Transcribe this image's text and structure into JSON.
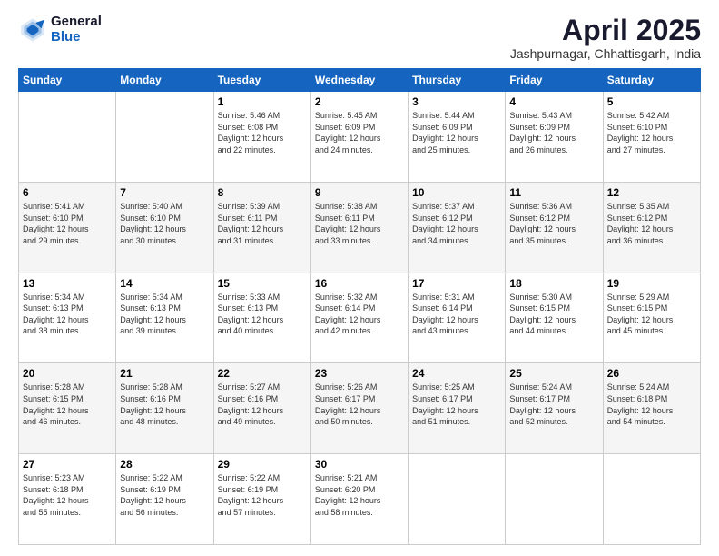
{
  "header": {
    "logo_general": "General",
    "logo_blue": "Blue",
    "title": "April 2025",
    "location": "Jashpurnagar, Chhattisgarh, India"
  },
  "days_of_week": [
    "Sunday",
    "Monday",
    "Tuesday",
    "Wednesday",
    "Thursday",
    "Friday",
    "Saturday"
  ],
  "weeks": [
    [
      {
        "day": "",
        "sunrise": "",
        "sunset": "",
        "daylight": ""
      },
      {
        "day": "",
        "sunrise": "",
        "sunset": "",
        "daylight": ""
      },
      {
        "day": "1",
        "sunrise": "Sunrise: 5:46 AM",
        "sunset": "Sunset: 6:08 PM",
        "daylight": "Daylight: 12 hours and 22 minutes."
      },
      {
        "day": "2",
        "sunrise": "Sunrise: 5:45 AM",
        "sunset": "Sunset: 6:09 PM",
        "daylight": "Daylight: 12 hours and 24 minutes."
      },
      {
        "day": "3",
        "sunrise": "Sunrise: 5:44 AM",
        "sunset": "Sunset: 6:09 PM",
        "daylight": "Daylight: 12 hours and 25 minutes."
      },
      {
        "day": "4",
        "sunrise": "Sunrise: 5:43 AM",
        "sunset": "Sunset: 6:09 PM",
        "daylight": "Daylight: 12 hours and 26 minutes."
      },
      {
        "day": "5",
        "sunrise": "Sunrise: 5:42 AM",
        "sunset": "Sunset: 6:10 PM",
        "daylight": "Daylight: 12 hours and 27 minutes."
      }
    ],
    [
      {
        "day": "6",
        "sunrise": "Sunrise: 5:41 AM",
        "sunset": "Sunset: 6:10 PM",
        "daylight": "Daylight: 12 hours and 29 minutes."
      },
      {
        "day": "7",
        "sunrise": "Sunrise: 5:40 AM",
        "sunset": "Sunset: 6:10 PM",
        "daylight": "Daylight: 12 hours and 30 minutes."
      },
      {
        "day": "8",
        "sunrise": "Sunrise: 5:39 AM",
        "sunset": "Sunset: 6:11 PM",
        "daylight": "Daylight: 12 hours and 31 minutes."
      },
      {
        "day": "9",
        "sunrise": "Sunrise: 5:38 AM",
        "sunset": "Sunset: 6:11 PM",
        "daylight": "Daylight: 12 hours and 33 minutes."
      },
      {
        "day": "10",
        "sunrise": "Sunrise: 5:37 AM",
        "sunset": "Sunset: 6:12 PM",
        "daylight": "Daylight: 12 hours and 34 minutes."
      },
      {
        "day": "11",
        "sunrise": "Sunrise: 5:36 AM",
        "sunset": "Sunset: 6:12 PM",
        "daylight": "Daylight: 12 hours and 35 minutes."
      },
      {
        "day": "12",
        "sunrise": "Sunrise: 5:35 AM",
        "sunset": "Sunset: 6:12 PM",
        "daylight": "Daylight: 12 hours and 36 minutes."
      }
    ],
    [
      {
        "day": "13",
        "sunrise": "Sunrise: 5:34 AM",
        "sunset": "Sunset: 6:13 PM",
        "daylight": "Daylight: 12 hours and 38 minutes."
      },
      {
        "day": "14",
        "sunrise": "Sunrise: 5:34 AM",
        "sunset": "Sunset: 6:13 PM",
        "daylight": "Daylight: 12 hours and 39 minutes."
      },
      {
        "day": "15",
        "sunrise": "Sunrise: 5:33 AM",
        "sunset": "Sunset: 6:13 PM",
        "daylight": "Daylight: 12 hours and 40 minutes."
      },
      {
        "day": "16",
        "sunrise": "Sunrise: 5:32 AM",
        "sunset": "Sunset: 6:14 PM",
        "daylight": "Daylight: 12 hours and 42 minutes."
      },
      {
        "day": "17",
        "sunrise": "Sunrise: 5:31 AM",
        "sunset": "Sunset: 6:14 PM",
        "daylight": "Daylight: 12 hours and 43 minutes."
      },
      {
        "day": "18",
        "sunrise": "Sunrise: 5:30 AM",
        "sunset": "Sunset: 6:15 PM",
        "daylight": "Daylight: 12 hours and 44 minutes."
      },
      {
        "day": "19",
        "sunrise": "Sunrise: 5:29 AM",
        "sunset": "Sunset: 6:15 PM",
        "daylight": "Daylight: 12 hours and 45 minutes."
      }
    ],
    [
      {
        "day": "20",
        "sunrise": "Sunrise: 5:28 AM",
        "sunset": "Sunset: 6:15 PM",
        "daylight": "Daylight: 12 hours and 46 minutes."
      },
      {
        "day": "21",
        "sunrise": "Sunrise: 5:28 AM",
        "sunset": "Sunset: 6:16 PM",
        "daylight": "Daylight: 12 hours and 48 minutes."
      },
      {
        "day": "22",
        "sunrise": "Sunrise: 5:27 AM",
        "sunset": "Sunset: 6:16 PM",
        "daylight": "Daylight: 12 hours and 49 minutes."
      },
      {
        "day": "23",
        "sunrise": "Sunrise: 5:26 AM",
        "sunset": "Sunset: 6:17 PM",
        "daylight": "Daylight: 12 hours and 50 minutes."
      },
      {
        "day": "24",
        "sunrise": "Sunrise: 5:25 AM",
        "sunset": "Sunset: 6:17 PM",
        "daylight": "Daylight: 12 hours and 51 minutes."
      },
      {
        "day": "25",
        "sunrise": "Sunrise: 5:24 AM",
        "sunset": "Sunset: 6:17 PM",
        "daylight": "Daylight: 12 hours and 52 minutes."
      },
      {
        "day": "26",
        "sunrise": "Sunrise: 5:24 AM",
        "sunset": "Sunset: 6:18 PM",
        "daylight": "Daylight: 12 hours and 54 minutes."
      }
    ],
    [
      {
        "day": "27",
        "sunrise": "Sunrise: 5:23 AM",
        "sunset": "Sunset: 6:18 PM",
        "daylight": "Daylight: 12 hours and 55 minutes."
      },
      {
        "day": "28",
        "sunrise": "Sunrise: 5:22 AM",
        "sunset": "Sunset: 6:19 PM",
        "daylight": "Daylight: 12 hours and 56 minutes."
      },
      {
        "day": "29",
        "sunrise": "Sunrise: 5:22 AM",
        "sunset": "Sunset: 6:19 PM",
        "daylight": "Daylight: 12 hours and 57 minutes."
      },
      {
        "day": "30",
        "sunrise": "Sunrise: 5:21 AM",
        "sunset": "Sunset: 6:20 PM",
        "daylight": "Daylight: 12 hours and 58 minutes."
      },
      {
        "day": "",
        "sunrise": "",
        "sunset": "",
        "daylight": ""
      },
      {
        "day": "",
        "sunrise": "",
        "sunset": "",
        "daylight": ""
      },
      {
        "day": "",
        "sunrise": "",
        "sunset": "",
        "daylight": ""
      }
    ]
  ]
}
